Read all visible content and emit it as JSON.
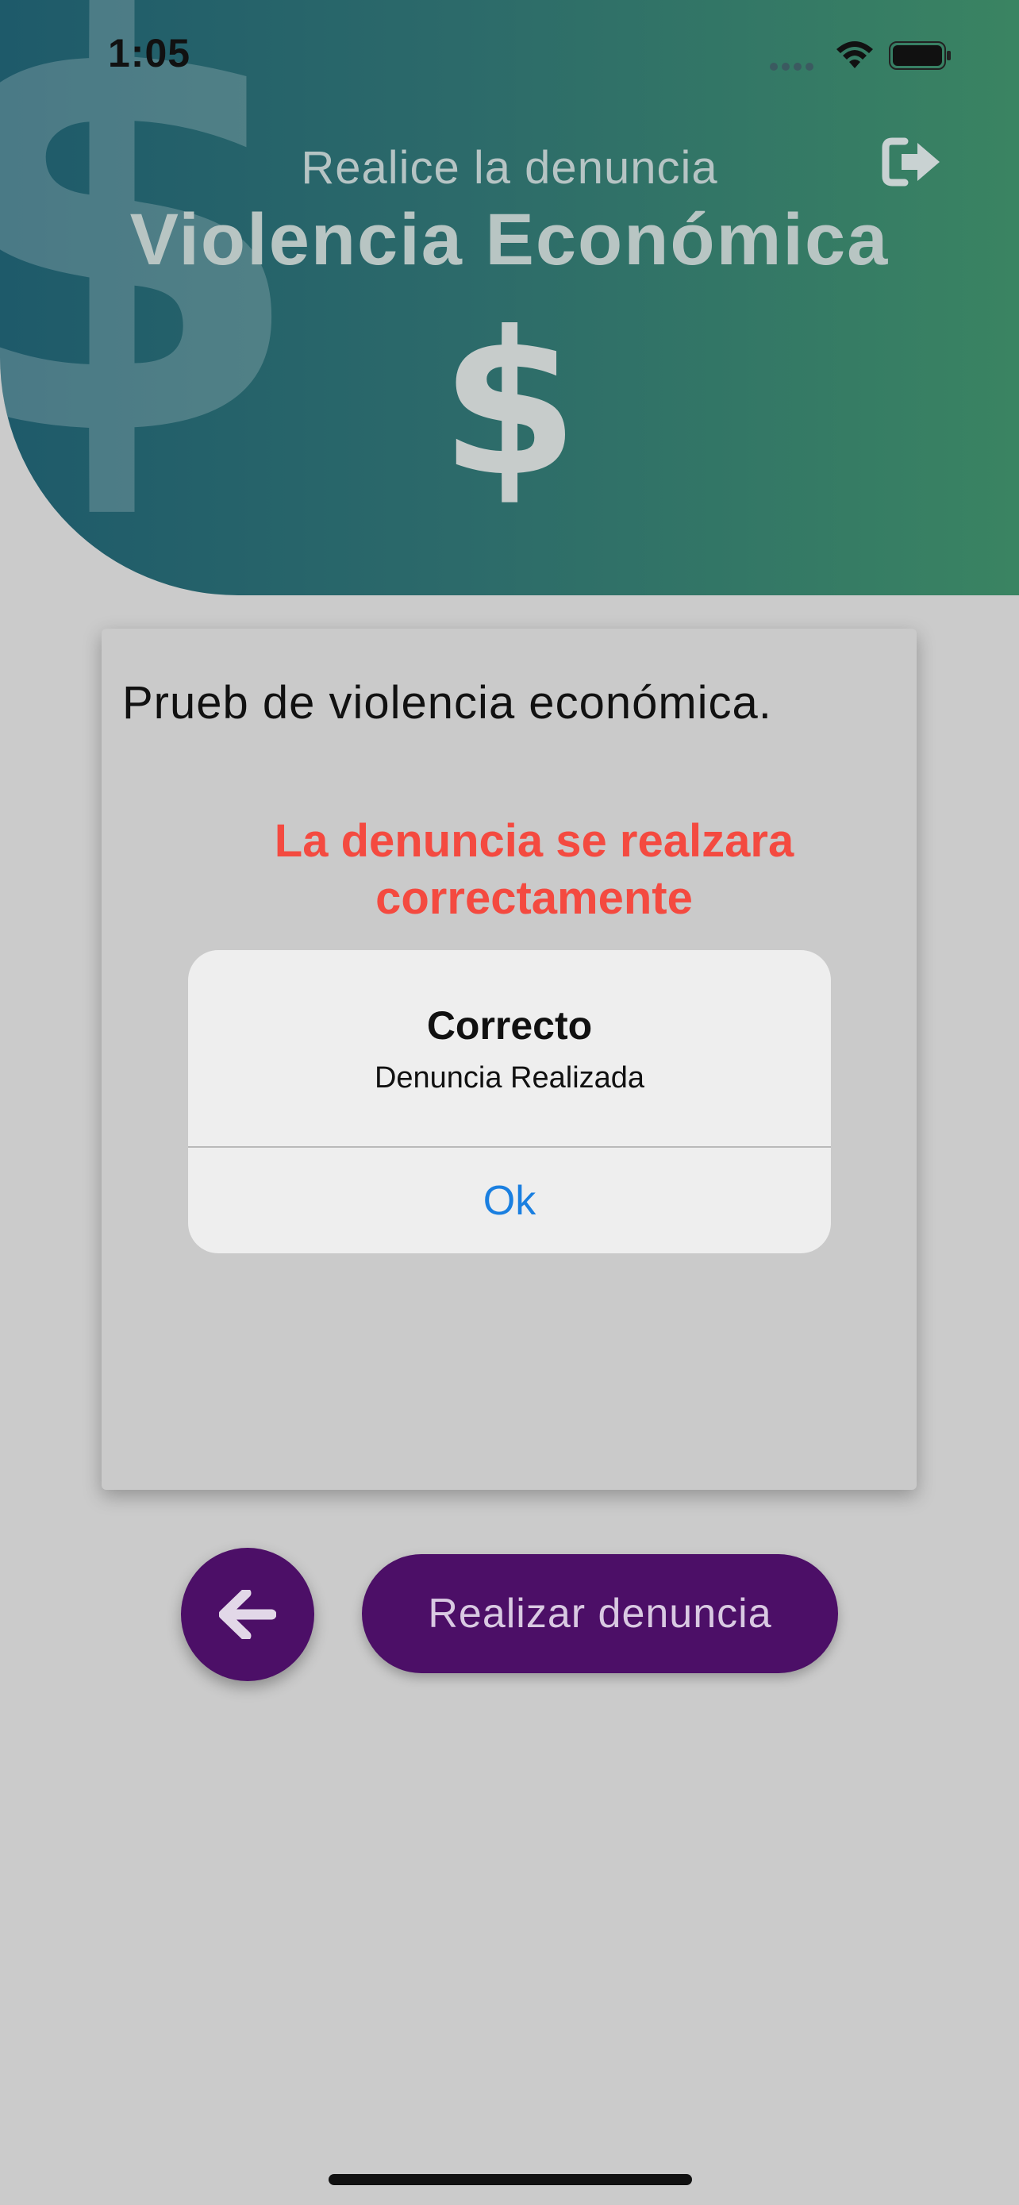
{
  "status_bar": {
    "time": "1:05"
  },
  "header": {
    "subtitle": "Realice la denuncia",
    "title": "Violencia Económica",
    "icon_glyph": "$",
    "logout_icon": "logout-icon"
  },
  "card": {
    "text": "Prueb de violencia económica.",
    "error_line1": "La denuncia se realzara",
    "error_line2": "correctamente"
  },
  "alert": {
    "title": "Correcto",
    "message": "Denuncia Realizada",
    "ok_label": "Ok"
  },
  "actions": {
    "back_icon": "arrow-left-icon",
    "report_label": "Realizar denuncia"
  },
  "colors": {
    "header_gradient_start": "#1e5a6a",
    "header_gradient_end": "#3a8462",
    "button_purple": "#4c0f67",
    "error_red": "#f44a40",
    "link_blue": "#1a7fe0"
  }
}
